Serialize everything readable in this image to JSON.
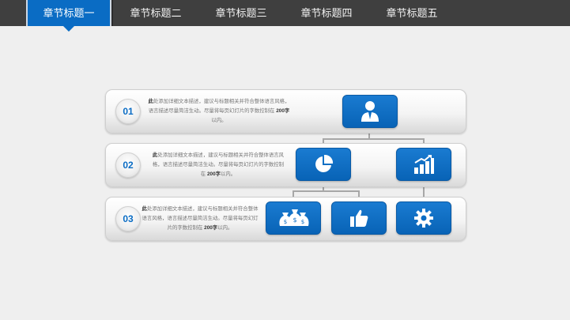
{
  "nav": {
    "tabs": [
      {
        "label": "章节标题一",
        "active": true
      },
      {
        "label": "章节标题二",
        "active": false
      },
      {
        "label": "章节标题三",
        "active": false
      },
      {
        "label": "章节标题四",
        "active": false
      },
      {
        "label": "章节标题五",
        "active": false
      }
    ]
  },
  "rows": [
    {
      "number": "01",
      "text_lead": "此",
      "text_lines": [
        "处添加详细文本描述，建议与标题相关并符合整体语言风格，",
        "语言描述尽量简洁生动。尽量将每页幻灯片的字数控制在 ",
        "以内。"
      ],
      "text_bold": "200字",
      "icons": [
        "user-icon"
      ]
    },
    {
      "number": "02",
      "text_lead": "此",
      "text_lines": [
        "处添加详细文本描述，建议与标题相关并符合整体语言风",
        "格，语言描述尽量简洁生动。尽量将每页幻灯片的字数控制",
        "在 ",
        "以内。"
      ],
      "text_bold": "200字",
      "icons": [
        "pie-chart-icon",
        "bar-chart-icon"
      ]
    },
    {
      "number": "03",
      "text_lead": "此",
      "text_lines": [
        "处添加详细文本描述，建议与标题相关并符合整体",
        "语言风格，语言描述尽量简洁生动。尽量将每页幻灯",
        "片的字数控制在 ",
        "以内。"
      ],
      "text_bold": "200字",
      "icons": [
        "money-bags-icon",
        "thumbs-up-icon",
        "gear-icon"
      ]
    }
  ],
  "colors": {
    "accent": "#0a6cc4",
    "nav_bg": "#3f3f3f",
    "background": "#efefef"
  }
}
